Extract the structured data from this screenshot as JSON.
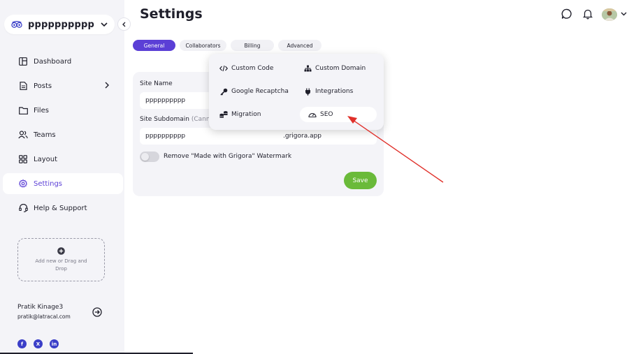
{
  "site": {
    "name": "pppppppppp"
  },
  "sidebar": {
    "items": [
      {
        "label": "Dashboard",
        "icon": "dashboard-icon"
      },
      {
        "label": "Posts",
        "icon": "posts-icon"
      },
      {
        "label": "Files",
        "icon": "folder-icon"
      },
      {
        "label": "Teams",
        "icon": "teams-icon"
      },
      {
        "label": "Layout",
        "icon": "layout-icon"
      },
      {
        "label": "Settings",
        "icon": "gear-icon",
        "active": true
      },
      {
        "label": "Help & Support",
        "icon": "headset-icon"
      }
    ],
    "dropzone_label": "Add new or Drag and Drop"
  },
  "user": {
    "name": "Pratik Kinage3",
    "email": "pratik@latracal.com"
  },
  "header": {
    "title": "Settings"
  },
  "tabs": [
    {
      "label": "General",
      "active": true
    },
    {
      "label": "Collaborators"
    },
    {
      "label": "Billing"
    },
    {
      "label": "Advanced"
    }
  ],
  "form": {
    "site_name_label": "Site Name",
    "site_name_value": "pppppppppp",
    "subdomain_label": "Site Subdomain",
    "subdomain_note": "(Cann",
    "subdomain_value": "pppppppppp",
    "subdomain_suffix": ".grigora.app",
    "watermark_label": "Remove \"Made with Grigora\" Watermark",
    "watermark_enabled": false,
    "save_label": "Save"
  },
  "advanced_menu": [
    {
      "label": "Custom Code",
      "icon": "code-icon"
    },
    {
      "label": "Custom Domain",
      "icon": "sitemap-icon"
    },
    {
      "label": "Google Recaptcha",
      "icon": "key-icon"
    },
    {
      "label": "Integrations",
      "icon": "plug-icon"
    },
    {
      "label": "Migration",
      "icon": "database-icon"
    },
    {
      "label": "SEO",
      "icon": "gauge-icon",
      "highlighted": true
    }
  ],
  "colors": {
    "accent": "#5b3fd6",
    "save_button": "#6aba3a",
    "annotation_arrow": "#e0302a",
    "social": "#3b3fc8"
  }
}
